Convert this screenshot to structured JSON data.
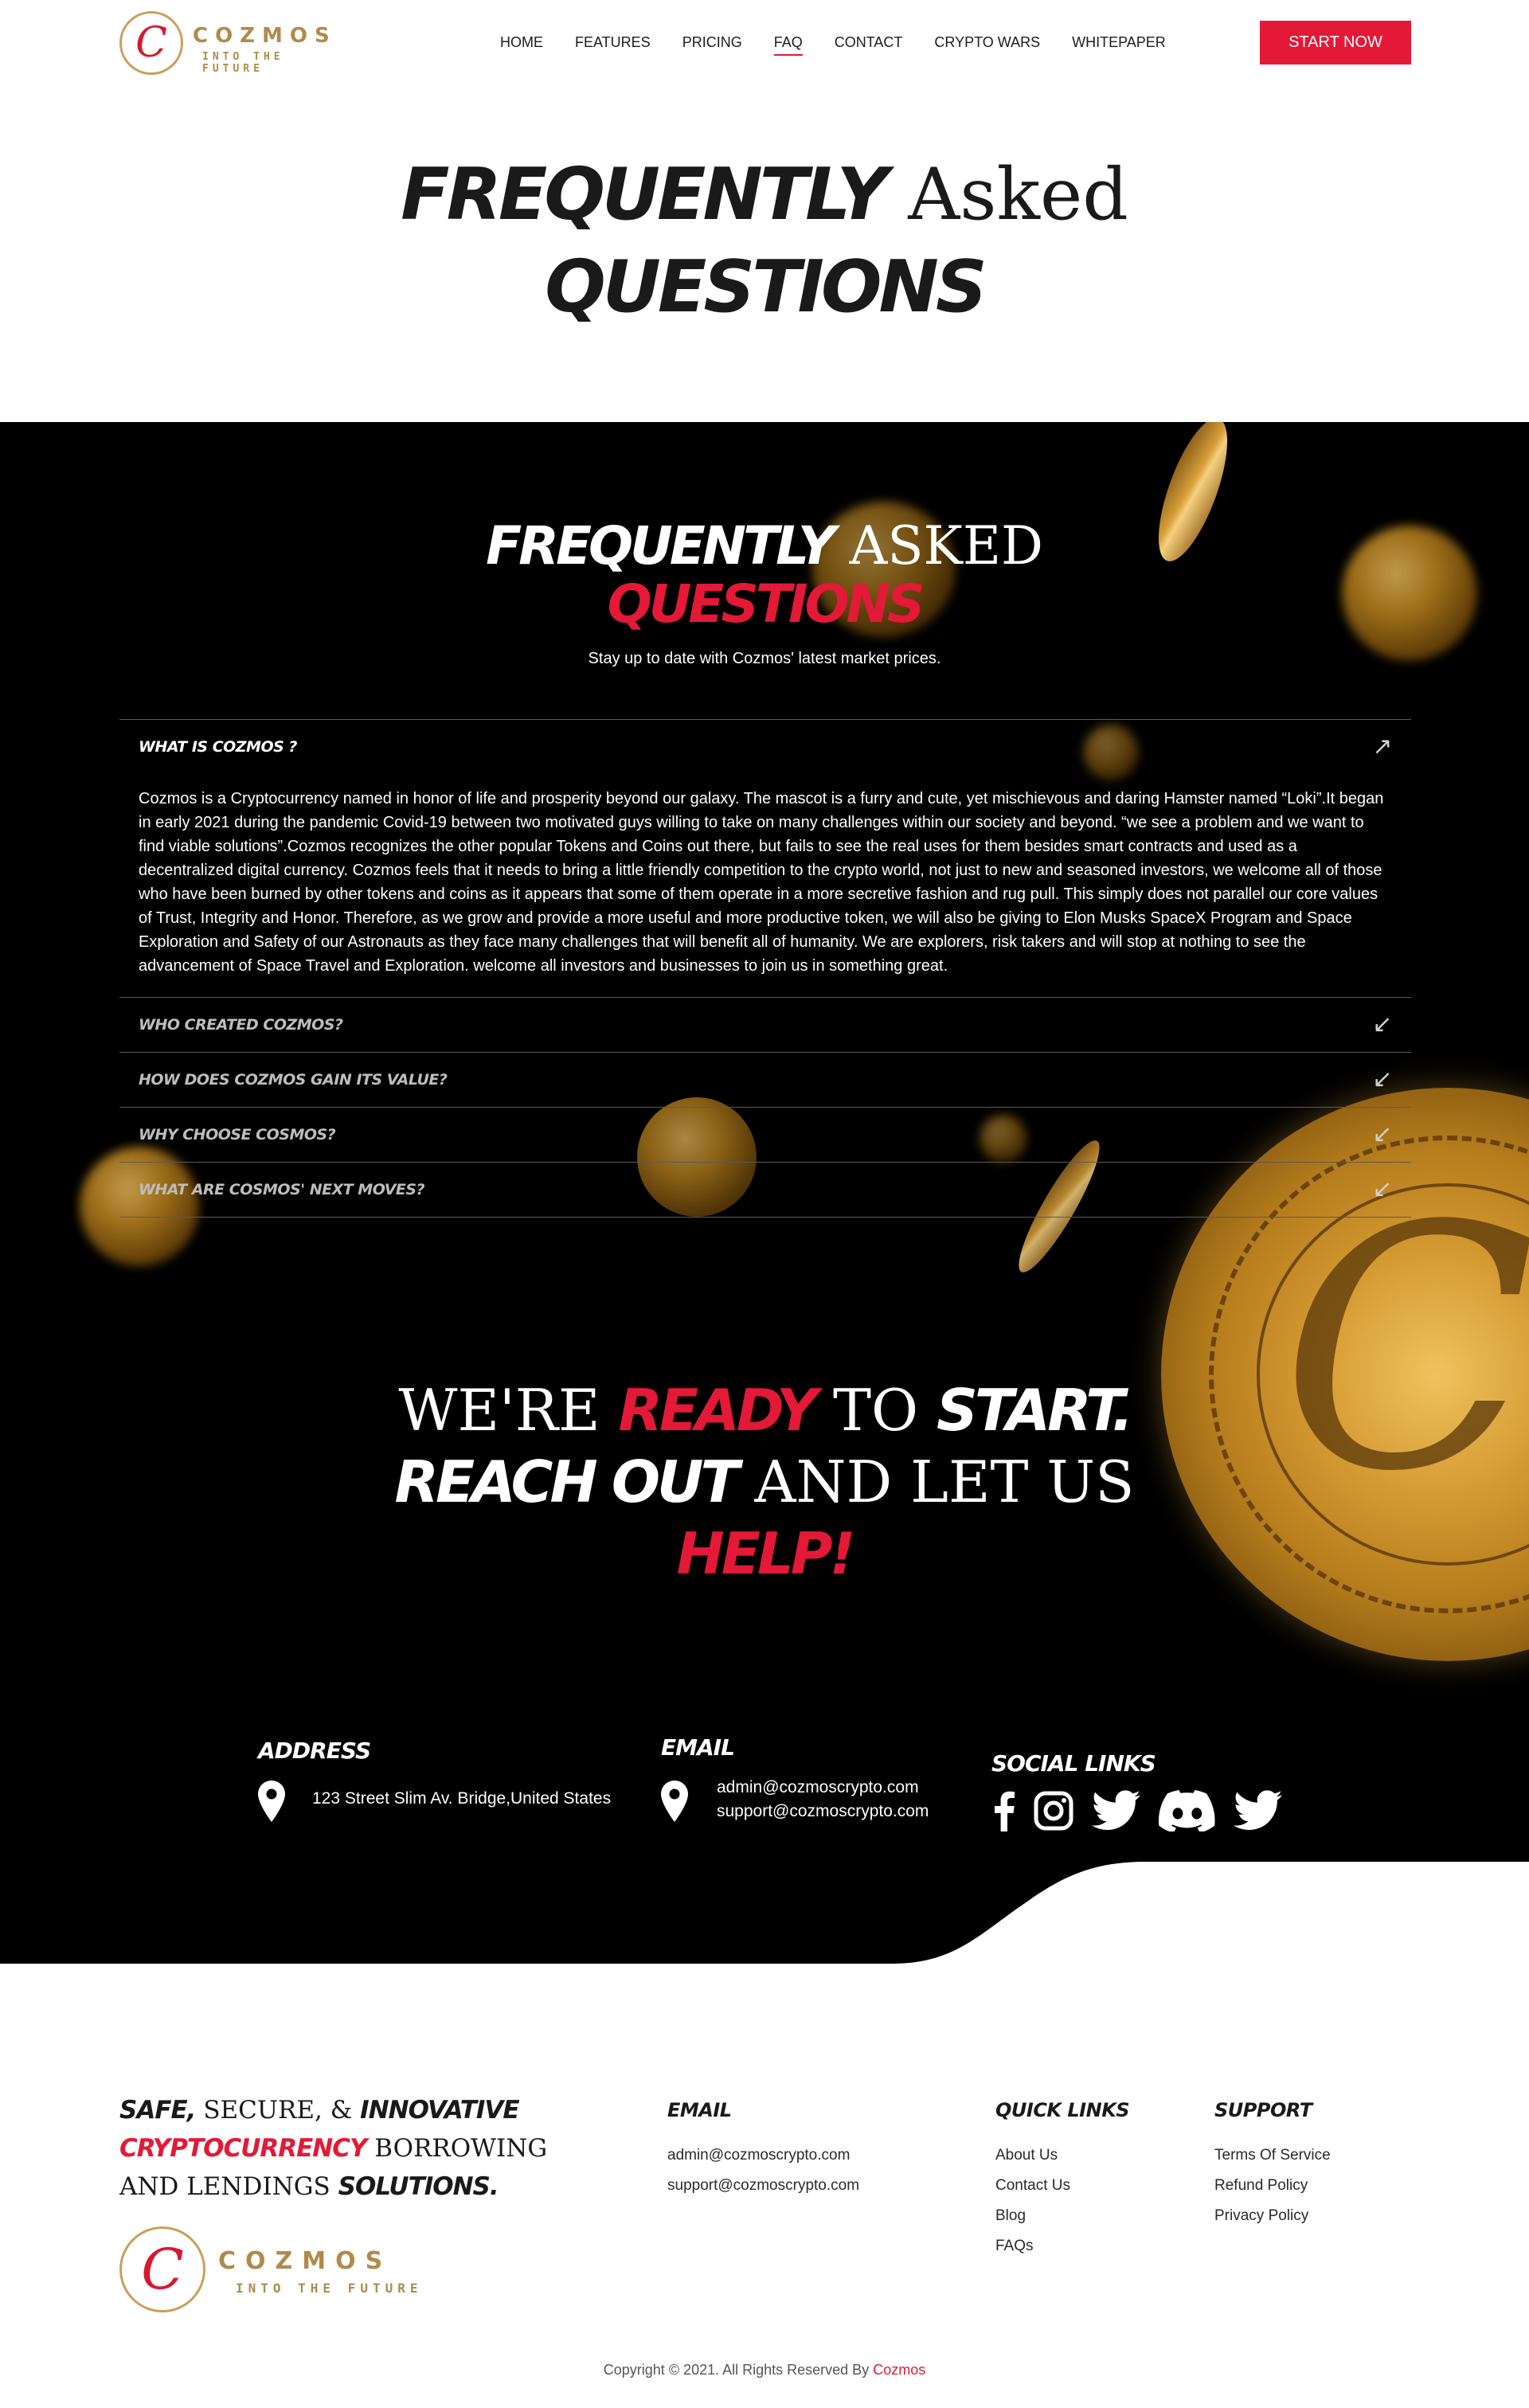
{
  "brand": {
    "logo_letter": "C",
    "name": "COZMOS",
    "tagline": "INTO THE FUTURE",
    "accent_color": "#e31937",
    "gold_color": "#b18a4a"
  },
  "nav": {
    "items": [
      {
        "label": "HOME",
        "active": false
      },
      {
        "label": "FEATURES",
        "active": false
      },
      {
        "label": "PRICING",
        "active": false
      },
      {
        "label": "FAQ",
        "active": true
      },
      {
        "label": "CONTACT",
        "active": false
      },
      {
        "label": "CRYPTO WARS",
        "active": false
      },
      {
        "label": "WHITEPAPER",
        "active": false
      }
    ],
    "cta_label": "START NOW"
  },
  "hero": {
    "bold_1": "FREQUENTLY",
    "serif_1": "Asked",
    "bold_2": "QUESTIONS"
  },
  "faq": {
    "heading_bold": "FREQUENTLY",
    "heading_serif": "ASKED",
    "heading_red": "QUESTIONS",
    "subtitle": "Stay up to date with Cozmos' latest market prices.",
    "items": [
      {
        "question": "WHAT IS COZMOS ?",
        "open": true,
        "answer": "Cozmos is a Cryptocurrency named in honor of life and prosperity beyond our galaxy. The mascot is a furry and cute, yet mischievous and daring Hamster named “Loki”.It began in early 2021 during the pandemic Covid-19 between two motivated guys willing to take on many challenges within our society and beyond. “we see a problem and we want to find viable solutions”.Cozmos recognizes the other popular Tokens and Coins out there, but fails to see the real uses for them besides smart contracts and used as a decentralized digital currency. Cozmos feels that it needs to bring a little friendly competition to the crypto world, not just to new and seasoned investors, we welcome all of those who have been burned by other tokens and coins as it appears that some of them operate in a more secretive fashion and rug pull. This simply does not parallel our core values of Trust, Integrity and Honor. Therefore, as we grow and provide a more useful and more productive token, we will also be giving to Elon Musks SpaceX Program and Space Exploration and Safety of our Astronauts as they face many challenges that will benefit all of humanity. We are explorers, risk takers and will stop at nothing to see the advancement of Space Travel and Exploration. welcome all investors and businesses to join us in something great."
      },
      {
        "question": "WHO CREATED COZMOS?",
        "open": false
      },
      {
        "question": "HOW DOES COZMOS GAIN ITS VALUE?",
        "open": false
      },
      {
        "question": "WHY CHOOSE COSMOS?",
        "open": false
      },
      {
        "question": "WHAT ARE COSMOS' NEXT MOVES?",
        "open": false
      }
    ]
  },
  "ready": {
    "l1_serif_a": "WE'RE",
    "l1_red": "READY",
    "l1_serif_b": "TO",
    "l1_bold": "START.",
    "l2_bold": "REACH OUT",
    "l2_serif": "AND LET US",
    "l3_red": "HELP!"
  },
  "contact": {
    "address_title": "ADDRESS",
    "address": "123 Street Slim Av. Bridge,United States",
    "email_title": "EMAIL",
    "email_1": "admin@cozmoscrypto.com",
    "email_2": "support@cozmoscrypto.com",
    "social_title": "SOCIAL LINKS",
    "social_icons": [
      "facebook-icon",
      "instagram-icon",
      "twitter-icon",
      "discord-icon",
      "twitter-icon"
    ]
  },
  "footer": {
    "tag": {
      "b1": "SAFE,",
      "s1": "SECURE, &",
      "b2": "INNOVATIVE",
      "red": "CRYPTOCURRENCY",
      "s2": "BORROWING",
      "s3": "AND LENDINGS",
      "b3": "SOLUTIONS."
    },
    "email_title": "EMAIL",
    "email_1": "admin@cozmoscrypto.com",
    "email_2": "support@cozmoscrypto.com",
    "quick_title": "QUICK LINKS",
    "quick_links": [
      "About Us",
      "Contact Us",
      "Blog",
      "FAQs"
    ],
    "support_title": "SUPPORT",
    "support_links": [
      "Terms Of Service",
      "Refund Policy",
      "Privacy Policy"
    ],
    "copyright": "Copyright © 2021. All Rights Reserved By",
    "copyright_brand": "Cozmos"
  }
}
